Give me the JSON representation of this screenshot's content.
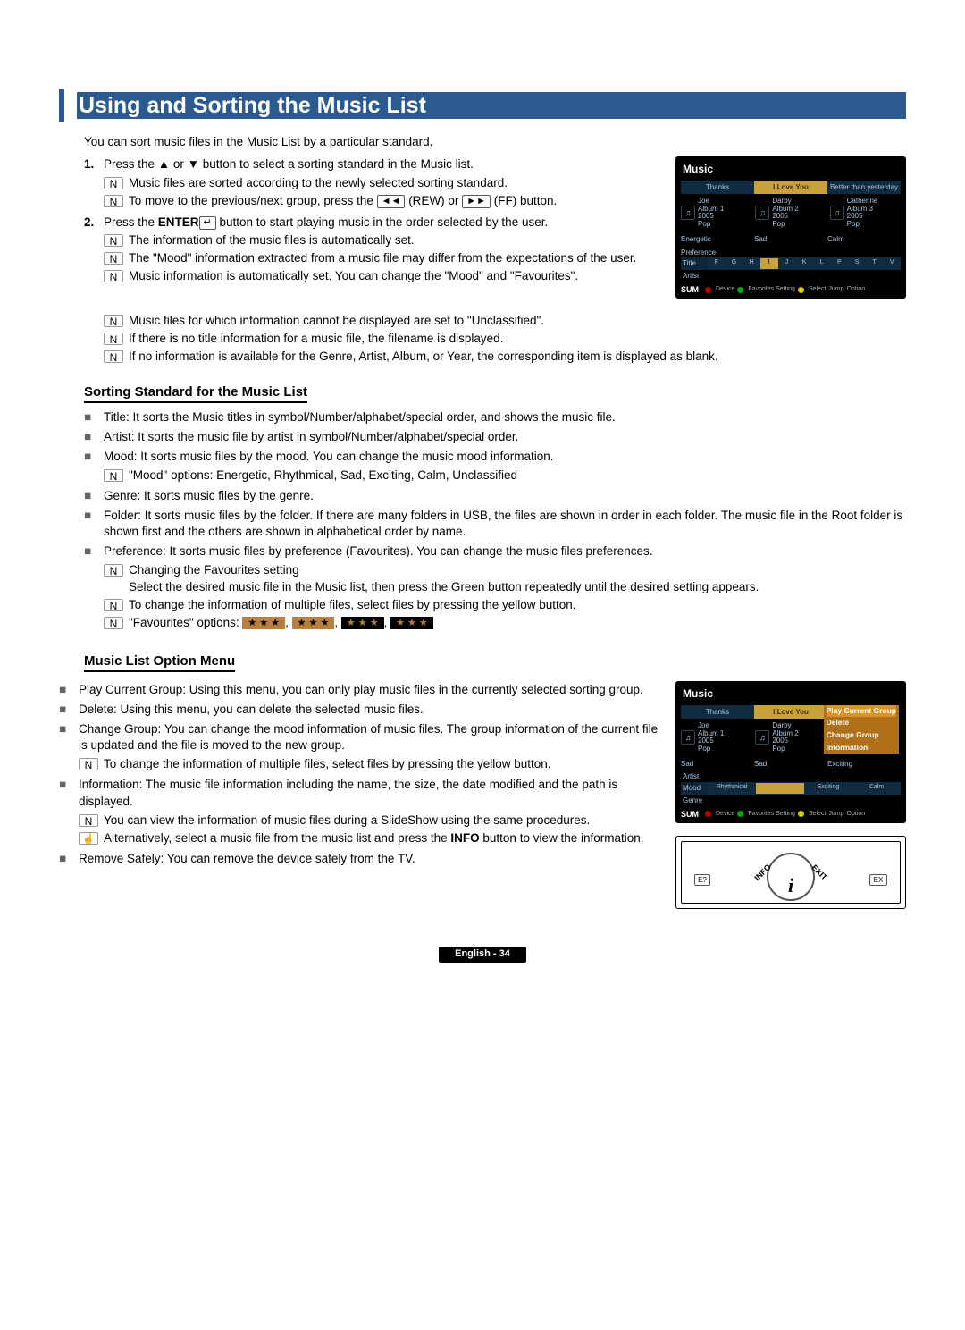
{
  "page_title": "Using and Sorting the Music List",
  "intro": "You can sort music files in the Music List by a particular standard.",
  "steps": [
    {
      "n": "1.",
      "text": "Press the ▲ or ▼ button to select a sorting standard in the Music list.",
      "notes": [
        "Music files are sorted according to the newly selected sorting standard.",
        "To move to the previous/next group, press the ◄◄ (REW) or ►► (FF) button."
      ]
    },
    {
      "n": "2.",
      "text_before": "Press the ",
      "text_bold": "ENTER",
      "text_after": " button to start playing music in the order selected by the user.",
      "notes": [
        "The information of the music files is automatically set.",
        "The \"Mood\" information extracted from a music file may differ from the expectations of the user.",
        "Music information is automatically set. You can change the \"Mood\" and \"Favourites\".",
        "Music files for which information cannot be displayed are set to \"Unclassified\".",
        "If there is no title information for a music file, the filename is displayed.",
        "If no information is available for the Genre, Artist, Album, or Year, the corresponding item is displayed as blank."
      ]
    }
  ],
  "sorting_heading": "Sorting Standard for the Music List",
  "sorting_items": [
    "Title: It sorts the Music titles in symbol/Number/alphabet/special order, and shows the music file.",
    "Artist: It sorts the music file by artist in symbol/Number/alphabet/special order.",
    "Mood: It sorts music files by the mood. You can change the music mood information.",
    "Genre: It sorts music files by the genre.",
    "Folder: It sorts music files by the folder. If there are many folders in USB, the files are shown in order in each folder. The music file in the Root folder is shown first and the others are shown in alphabetical order by name.",
    "Preference: It sorts music files by preference (Favourites). You can change the music files preferences."
  ],
  "mood_note": "\"Mood\" options: Energetic, Rhythmical, Sad, Exciting, Calm, Unclassified",
  "pref_notes": [
    "Changing the Favourites setting",
    "Select the desired music file in the Music list, then press the Green button repeatedly until the desired setting appears.",
    "To change the information of multiple files, select files by pressing the yellow button.",
    "\"Favourites\" options:"
  ],
  "favourites_options": [
    "★ ★ ★",
    "★ ★ ★",
    "★ ★ ★",
    "★ ★ ★"
  ],
  "option_heading": "Music List Option Menu",
  "option_items": [
    {
      "text": "Play Current Group: Using this menu, you can only play music files in the currently selected sorting group."
    },
    {
      "text": "Delete: Using this menu, you can delete the selected music files."
    },
    {
      "text": "Change Group: You can change the mood information of music files. The group information of the current file is updated and the file is moved to the new group.",
      "notes": [
        "To change the information of multiple files, select files by pressing the yellow button."
      ]
    },
    {
      "text": "Information: The music file information including the name, the size, the date modified and the path is displayed.",
      "notes": [
        "You can view the information of music files during a SlideShow using the same procedures."
      ],
      "press_note_pre": "Alternatively, select a music file from the music list and press the ",
      "press_note_bold": "INFO",
      "press_note_post": " button to view the information."
    },
    {
      "text": "Remove Safely: You can remove the device safely from the TV."
    }
  ],
  "screenshot1": {
    "title": "Music",
    "tabs": [
      "Thanks",
      "I Love You",
      "Better than yesterday"
    ],
    "tiles": [
      {
        "name": "Joe",
        "sub": "Album 1\n2005\nPop"
      },
      {
        "name": "Darby",
        "sub": "Album 2\n2005\nPop"
      },
      {
        "name": "Catherine",
        "sub": "Album 3\n2005\nPop"
      }
    ],
    "moods": [
      "Energetic",
      "Sad",
      "Calm"
    ],
    "sidebar": [
      "Preference",
      "Title",
      "Artist"
    ],
    "letters": [
      "F",
      "G",
      "H",
      "I",
      "J",
      "K",
      "L",
      "P",
      "S",
      "T",
      "V"
    ],
    "foot": {
      "sum": "SUM",
      "a": "Device",
      "b": "Favorites Setting",
      "c": "Select",
      "d": "Jump",
      "e": "Option"
    }
  },
  "screenshot2": {
    "title": "Music",
    "tabs": [
      "Thanks",
      "I Love You"
    ],
    "tiles": [
      {
        "name": "Joe",
        "sub": "Album 1\n2005\nPop"
      },
      {
        "name": "Darby",
        "sub": "Album 2\n2005\nPop"
      }
    ],
    "moods": [
      "Sad",
      "Sad",
      "Exciting"
    ],
    "menu": [
      "Play Current Group",
      "Delete",
      "Change Group",
      "Information"
    ],
    "sidebar": [
      "Artist",
      "Mood",
      "Genre"
    ],
    "mood_row": [
      "Rhythmical",
      "",
      "Exciting",
      "Calm"
    ],
    "foot": {
      "sum": "SUM",
      "a": "Device",
      "b": "Favorites Setting",
      "c": "Select",
      "d": "Jump",
      "e": "Option"
    }
  },
  "remote": {
    "info": "INFO",
    "exit": "EXIT",
    "l": "E?",
    "r": "EX"
  },
  "note_icon": "N",
  "press_icon": "☝",
  "page_foot": "English - 34"
}
